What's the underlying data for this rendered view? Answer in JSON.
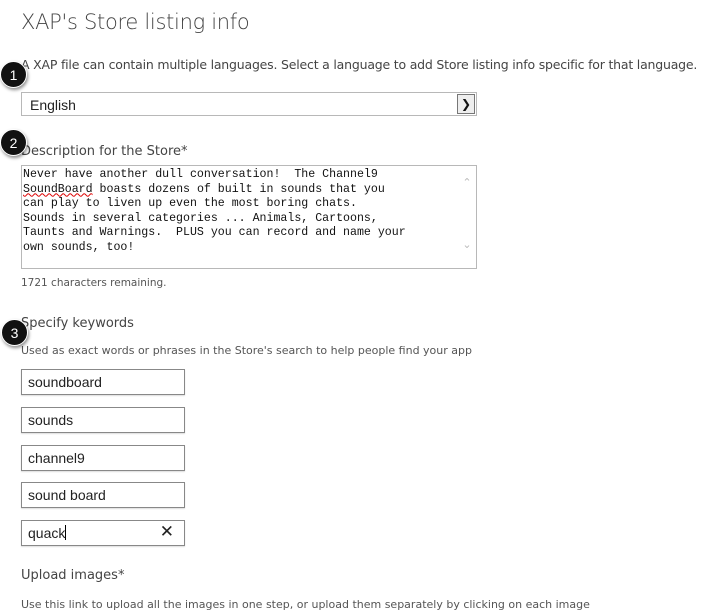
{
  "title": "XAP's Store listing info",
  "language_intro": "A XAP file can contain multiple languages. Select a language to add Store listing info specific for that language.",
  "language_select": {
    "value": "English"
  },
  "description": {
    "label": "Description for the Store*",
    "lines": [
      "Never have another dull conversation!  The Channel9",
      " boasts dozens of built in sounds that you",
      "can play to liven up even the most boring chats.",
      "Sounds in several categories ... Animals, Cartoons,",
      "Taunts and Warnings.  PLUS you can record and name your",
      "own sounds, too!"
    ],
    "misspelled_word": "SoundBoard",
    "remaining": "1721 characters remaining."
  },
  "keywords": {
    "label": "Specify keywords",
    "help": "Used as exact words or phrases in the Store's search to help people find your app",
    "values": [
      "soundboard",
      "sounds",
      "channel9",
      "sound board",
      "quack"
    ]
  },
  "upload": {
    "label": "Upload images*",
    "help": "Use this link to upload all the images in one step, or upload them separately by clicking on each image"
  },
  "badges": [
    "1",
    "2",
    "3"
  ]
}
